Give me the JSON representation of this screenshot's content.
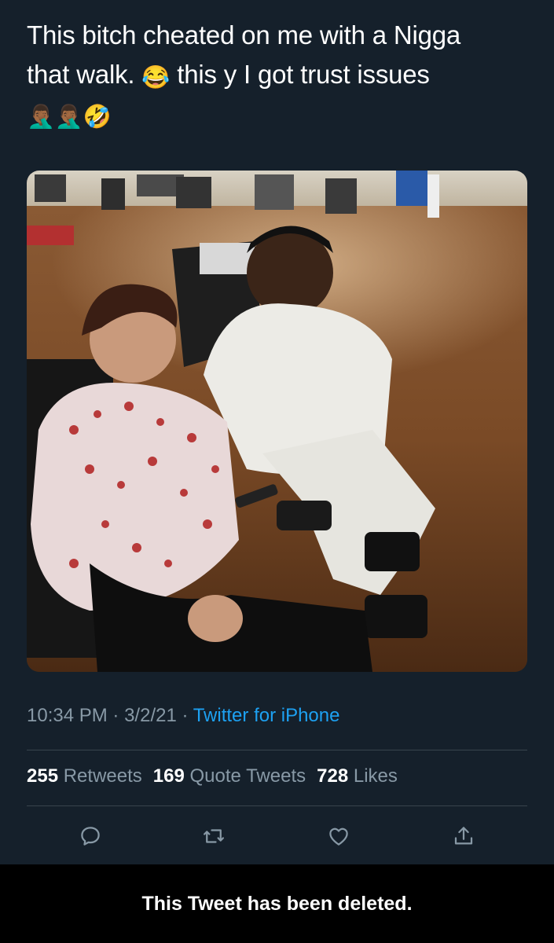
{
  "tweet": {
    "text_line1": "This bitch cheated on me with a Nigga",
    "text_line2a": "that walk.",
    "emoji_joy": "😂",
    "text_line2b": "this y I got trust issues",
    "emoji_facepalm_1": "🤦🏾‍♂️",
    "emoji_facepalm_2": "🤦🏾‍♂️",
    "emoji_rofl": "🤣"
  },
  "meta": {
    "time": "10:34 PM",
    "separator": "·",
    "date": "3/2/21",
    "source": "Twitter for iPhone"
  },
  "stats": {
    "retweets_count": "255",
    "retweets_label": "Retweets",
    "quotes_count": "169",
    "quotes_label": "Quote Tweets",
    "likes_count": "728",
    "likes_label": "Likes"
  },
  "actions": {
    "reply_icon": "speech-bubble",
    "retweet_icon": "retweet-arrows",
    "like_icon": "heart",
    "share_icon": "share-upload"
  },
  "banner": {
    "text": "This Tweet has been deleted."
  },
  "colors": {
    "background": "#15202b",
    "secondary_text": "#8899a6",
    "link": "#1da1f2",
    "divider": "#38444d",
    "banner_bg": "#000000"
  }
}
